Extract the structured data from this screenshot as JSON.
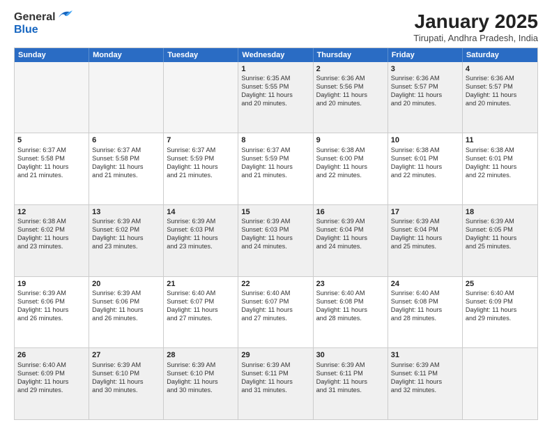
{
  "header": {
    "logo_general": "General",
    "logo_blue": "Blue",
    "month_title": "January 2025",
    "location": "Tirupati, Andhra Pradesh, India"
  },
  "days_of_week": [
    "Sunday",
    "Monday",
    "Tuesday",
    "Wednesday",
    "Thursday",
    "Friday",
    "Saturday"
  ],
  "rows": [
    [
      {
        "day": "",
        "lines": []
      },
      {
        "day": "",
        "lines": []
      },
      {
        "day": "",
        "lines": []
      },
      {
        "day": "1",
        "lines": [
          "Sunrise: 6:35 AM",
          "Sunset: 5:55 PM",
          "Daylight: 11 hours",
          "and 20 minutes."
        ]
      },
      {
        "day": "2",
        "lines": [
          "Sunrise: 6:36 AM",
          "Sunset: 5:56 PM",
          "Daylight: 11 hours",
          "and 20 minutes."
        ]
      },
      {
        "day": "3",
        "lines": [
          "Sunrise: 6:36 AM",
          "Sunset: 5:57 PM",
          "Daylight: 11 hours",
          "and 20 minutes."
        ]
      },
      {
        "day": "4",
        "lines": [
          "Sunrise: 6:36 AM",
          "Sunset: 5:57 PM",
          "Daylight: 11 hours",
          "and 20 minutes."
        ]
      }
    ],
    [
      {
        "day": "5",
        "lines": [
          "Sunrise: 6:37 AM",
          "Sunset: 5:58 PM",
          "Daylight: 11 hours",
          "and 21 minutes."
        ]
      },
      {
        "day": "6",
        "lines": [
          "Sunrise: 6:37 AM",
          "Sunset: 5:58 PM",
          "Daylight: 11 hours",
          "and 21 minutes."
        ]
      },
      {
        "day": "7",
        "lines": [
          "Sunrise: 6:37 AM",
          "Sunset: 5:59 PM",
          "Daylight: 11 hours",
          "and 21 minutes."
        ]
      },
      {
        "day": "8",
        "lines": [
          "Sunrise: 6:37 AM",
          "Sunset: 5:59 PM",
          "Daylight: 11 hours",
          "and 21 minutes."
        ]
      },
      {
        "day": "9",
        "lines": [
          "Sunrise: 6:38 AM",
          "Sunset: 6:00 PM",
          "Daylight: 11 hours",
          "and 22 minutes."
        ]
      },
      {
        "day": "10",
        "lines": [
          "Sunrise: 6:38 AM",
          "Sunset: 6:01 PM",
          "Daylight: 11 hours",
          "and 22 minutes."
        ]
      },
      {
        "day": "11",
        "lines": [
          "Sunrise: 6:38 AM",
          "Sunset: 6:01 PM",
          "Daylight: 11 hours",
          "and 22 minutes."
        ]
      }
    ],
    [
      {
        "day": "12",
        "lines": [
          "Sunrise: 6:38 AM",
          "Sunset: 6:02 PM",
          "Daylight: 11 hours",
          "and 23 minutes."
        ]
      },
      {
        "day": "13",
        "lines": [
          "Sunrise: 6:39 AM",
          "Sunset: 6:02 PM",
          "Daylight: 11 hours",
          "and 23 minutes."
        ]
      },
      {
        "day": "14",
        "lines": [
          "Sunrise: 6:39 AM",
          "Sunset: 6:03 PM",
          "Daylight: 11 hours",
          "and 23 minutes."
        ]
      },
      {
        "day": "15",
        "lines": [
          "Sunrise: 6:39 AM",
          "Sunset: 6:03 PM",
          "Daylight: 11 hours",
          "and 24 minutes."
        ]
      },
      {
        "day": "16",
        "lines": [
          "Sunrise: 6:39 AM",
          "Sunset: 6:04 PM",
          "Daylight: 11 hours",
          "and 24 minutes."
        ]
      },
      {
        "day": "17",
        "lines": [
          "Sunrise: 6:39 AM",
          "Sunset: 6:04 PM",
          "Daylight: 11 hours",
          "and 25 minutes."
        ]
      },
      {
        "day": "18",
        "lines": [
          "Sunrise: 6:39 AM",
          "Sunset: 6:05 PM",
          "Daylight: 11 hours",
          "and 25 minutes."
        ]
      }
    ],
    [
      {
        "day": "19",
        "lines": [
          "Sunrise: 6:39 AM",
          "Sunset: 6:06 PM",
          "Daylight: 11 hours",
          "and 26 minutes."
        ]
      },
      {
        "day": "20",
        "lines": [
          "Sunrise: 6:39 AM",
          "Sunset: 6:06 PM",
          "Daylight: 11 hours",
          "and 26 minutes."
        ]
      },
      {
        "day": "21",
        "lines": [
          "Sunrise: 6:40 AM",
          "Sunset: 6:07 PM",
          "Daylight: 11 hours",
          "and 27 minutes."
        ]
      },
      {
        "day": "22",
        "lines": [
          "Sunrise: 6:40 AM",
          "Sunset: 6:07 PM",
          "Daylight: 11 hours",
          "and 27 minutes."
        ]
      },
      {
        "day": "23",
        "lines": [
          "Sunrise: 6:40 AM",
          "Sunset: 6:08 PM",
          "Daylight: 11 hours",
          "and 28 minutes."
        ]
      },
      {
        "day": "24",
        "lines": [
          "Sunrise: 6:40 AM",
          "Sunset: 6:08 PM",
          "Daylight: 11 hours",
          "and 28 minutes."
        ]
      },
      {
        "day": "25",
        "lines": [
          "Sunrise: 6:40 AM",
          "Sunset: 6:09 PM",
          "Daylight: 11 hours",
          "and 29 minutes."
        ]
      }
    ],
    [
      {
        "day": "26",
        "lines": [
          "Sunrise: 6:40 AM",
          "Sunset: 6:09 PM",
          "Daylight: 11 hours",
          "and 29 minutes."
        ]
      },
      {
        "day": "27",
        "lines": [
          "Sunrise: 6:39 AM",
          "Sunset: 6:10 PM",
          "Daylight: 11 hours",
          "and 30 minutes."
        ]
      },
      {
        "day": "28",
        "lines": [
          "Sunrise: 6:39 AM",
          "Sunset: 6:10 PM",
          "Daylight: 11 hours",
          "and 30 minutes."
        ]
      },
      {
        "day": "29",
        "lines": [
          "Sunrise: 6:39 AM",
          "Sunset: 6:11 PM",
          "Daylight: 11 hours",
          "and 31 minutes."
        ]
      },
      {
        "day": "30",
        "lines": [
          "Sunrise: 6:39 AM",
          "Sunset: 6:11 PM",
          "Daylight: 11 hours",
          "and 31 minutes."
        ]
      },
      {
        "day": "31",
        "lines": [
          "Sunrise: 6:39 AM",
          "Sunset: 6:11 PM",
          "Daylight: 11 hours",
          "and 32 minutes."
        ]
      },
      {
        "day": "",
        "lines": []
      }
    ]
  ]
}
